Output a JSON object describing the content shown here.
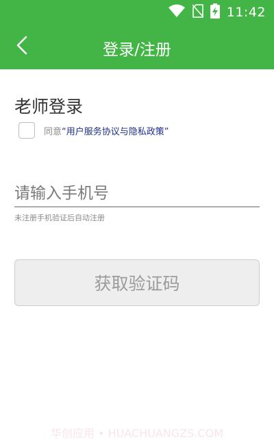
{
  "status_bar": {
    "time": "11:42",
    "icons": [
      "wifi-icon",
      "no-sim-icon",
      "battery-charging-icon"
    ]
  },
  "nav": {
    "back_icon": "chevron-left-icon",
    "title": "登录/注册"
  },
  "login": {
    "heading": "老师登录",
    "agree_prefix": "同意",
    "agree_link": "“用户服务协议与隐私政策”",
    "agree_checked": false,
    "phone_placeholder": "请输入手机号",
    "phone_value": "",
    "hint": "未注册手机验证后自动注册",
    "get_code_label": "获取验证码"
  },
  "watermark": "华创应用 • HUACHUANGZS.COM",
  "colors": {
    "primary": "#43b546",
    "link": "#1f2f8f",
    "button_bg": "#eeeeee",
    "button_text": "#9b9b9b"
  }
}
